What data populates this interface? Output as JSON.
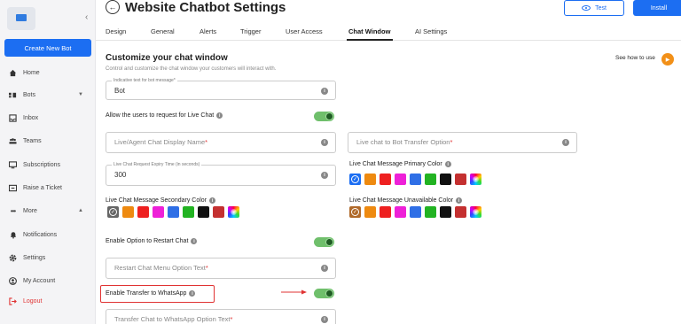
{
  "sidebar": {
    "logo_icon": "brand-logo-icon",
    "create_label": "Create New Bot",
    "items": [
      {
        "label": "Home",
        "icon": "home-icon"
      },
      {
        "label": "Bots",
        "icon": "bots-icon"
      },
      {
        "label": "Inbox",
        "icon": "inbox-icon"
      },
      {
        "label": "Teams",
        "icon": "teams-icon"
      },
      {
        "label": "Subscriptions",
        "icon": "subscriptions-icon"
      },
      {
        "label": "Raise a Ticket",
        "icon": "ticket-icon"
      },
      {
        "label": "More",
        "icon": "more-icon"
      },
      {
        "label": "Notifications",
        "icon": "bell-icon"
      },
      {
        "label": "Settings",
        "icon": "gear-icon"
      },
      {
        "label": "My Account",
        "icon": "account-icon"
      },
      {
        "label": "Logout",
        "icon": "logout-icon"
      }
    ]
  },
  "header": {
    "title": "Website Chatbot Settings",
    "test_label": "Test",
    "install_label": "Install"
  },
  "tabs": [
    "Design",
    "General",
    "Alerts",
    "Trigger",
    "User Access",
    "Chat Window",
    "AI Settings"
  ],
  "active_tab": "Chat Window",
  "section": {
    "title": "Customize your chat window",
    "description": "Control and customize the chat window your customers will interact with.",
    "how_to": "See how to use"
  },
  "fields": {
    "indicative_legend": "Indicative text for bot message*",
    "indicative_value": "Bot",
    "allow_live_chat": "Allow the users to request for Live Chat",
    "display_name_ph": "Live/Agent Chat Display Name",
    "transfer_option_ph": "Live chat to Bot Transfer Option",
    "expiry_legend": "Live Chat Request Expiry Time (in seconds)",
    "expiry_value": "300",
    "primary_color": "Live Chat Message Primary Color",
    "secondary_color": "Live Chat Message Secondary Color",
    "unavailable_color": "Live Chat Message Unavailable Color",
    "restart_label": "Enable Option to Restart Chat",
    "restart_ph": "Restart Chat Menu Option Text",
    "whatsapp_label": "Enable Transfer to WhatsApp",
    "whatsapp_ph": "Transfer Chat to WhatsApp Option Text",
    "required_mark": "*",
    "info_glyph": "i"
  },
  "toggles": {
    "live_chat": true,
    "restart_chat": true,
    "whatsapp": true
  },
  "colors": {
    "accent": "#1c6ef2",
    "highlight": "#e03333",
    "swatches": [
      "#ee8a10",
      "#ee2020",
      "#ee20d8",
      "#2f6fe6",
      "#22b322",
      "#111111",
      "#c43030",
      "rainbow"
    ],
    "primary_selected": "#1c6ef2",
    "secondary_selected": "#666666",
    "unavailable_selected": "#b06a2a"
  }
}
